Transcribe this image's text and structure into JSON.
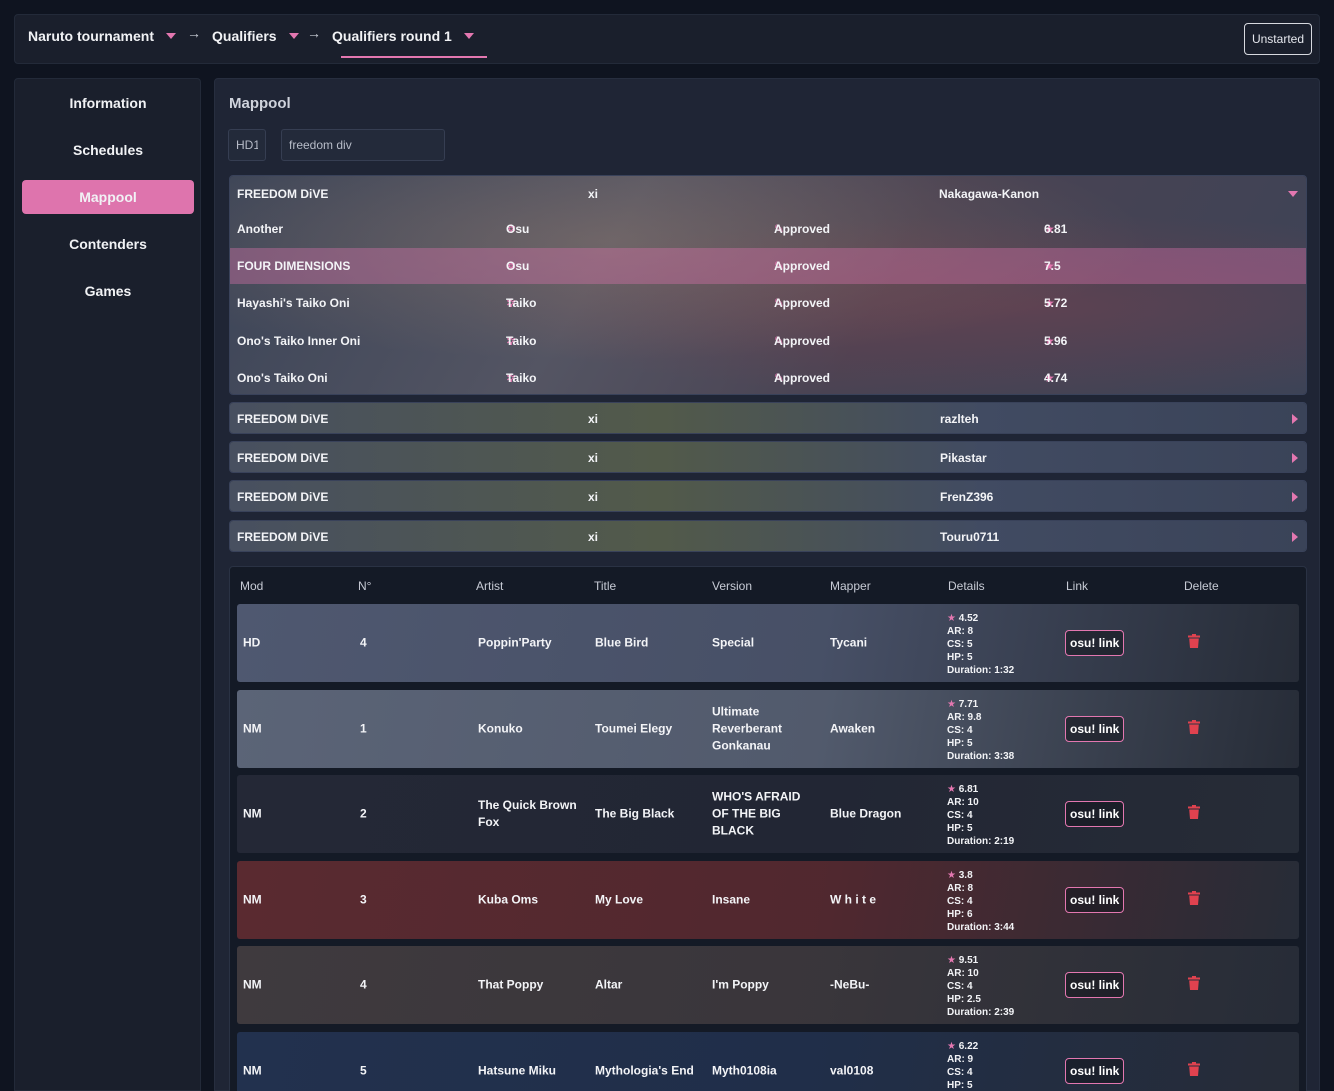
{
  "breadcrumb": {
    "items": [
      "Naruto tournament",
      "Qualifiers",
      "Qualifiers round 1"
    ],
    "status_button": "Unstarted"
  },
  "sidebar": {
    "items": [
      {
        "label": "Information"
      },
      {
        "label": "Schedules"
      },
      {
        "label": "Mappool",
        "active": true
      },
      {
        "label": "Contenders"
      },
      {
        "label": "Games"
      }
    ]
  },
  "mappool": {
    "title": "Mappool",
    "mod_input": {
      "value": "HD1"
    },
    "search_input": {
      "value": "freedom div"
    }
  },
  "beatmapsets": [
    {
      "title": "FREEDOM DiVE",
      "artist": "xi",
      "creator": "Nakagawa-Kanon",
      "expanded": true,
      "difficulties": [
        {
          "name": "Another",
          "mode": "Osu",
          "status": "Approved",
          "stars": "6.81"
        },
        {
          "name": "FOUR DIMENSIONS",
          "mode": "Osu",
          "status": "Approved",
          "stars": "7.5",
          "highlighted": true
        },
        {
          "name": "Hayashi's Taiko Oni",
          "mode": "Taiko",
          "status": "Approved",
          "stars": "5.72"
        },
        {
          "name": "Ono's Taiko Inner Oni",
          "mode": "Taiko",
          "status": "Approved",
          "stars": "5.96"
        },
        {
          "name": "Ono's Taiko Oni",
          "mode": "Taiko",
          "status": "Approved",
          "stars": "4.74"
        }
      ]
    },
    {
      "title": "FREEDOM DiVE",
      "artist": "xi",
      "creator": "razlteh"
    },
    {
      "title": "FREEDOM DiVE",
      "artist": "xi",
      "creator": "Pikastar"
    },
    {
      "title": "FREEDOM DiVE",
      "artist": "xi",
      "creator": "FrenZ396"
    },
    {
      "title": "FREEDOM DiVE",
      "artist": "xi",
      "creator": "Touru0711"
    }
  ],
  "table": {
    "headers": [
      "Mod",
      "N°",
      "Artist",
      "Title",
      "Version",
      "Mapper",
      "Details",
      "Link",
      "Delete"
    ],
    "link_label": "osu! link",
    "rows": [
      {
        "mod": "HD",
        "n": "4",
        "artist": "Poppin'Party",
        "title": "Blue Bird",
        "version": "Special",
        "mapper": "Tycani",
        "stars": "4.52",
        "ar": "AR: 8",
        "cs": "CS: 5",
        "hp": "HP: 5",
        "duration": "Duration: 1:32",
        "color": "#4f5870"
      },
      {
        "mod": "NM",
        "n": "1",
        "artist": "Konuko",
        "title": "Toumei Elegy",
        "version": "Ultimate Reverberant Gonkanau",
        "mapper": "Awaken",
        "stars": "7.71",
        "ar": "AR: 9.8",
        "cs": "CS: 4",
        "hp": "HP: 5",
        "duration": "Duration: 3:38",
        "color": "#5b6477"
      },
      {
        "mod": "NM",
        "n": "2",
        "artist": "The Quick Brown Fox",
        "title": "The Big Black",
        "version": "WHO'S AFRAID OF THE BIG BLACK",
        "mapper": "Blue Dragon",
        "stars": "6.81",
        "ar": "AR: 10",
        "cs": "CS: 4",
        "hp": "HP: 5",
        "duration": "Duration: 2:19",
        "color": "#242836"
      },
      {
        "mod": "NM",
        "n": "3",
        "artist": "Kuba Oms",
        "title": "My Love",
        "version": "Insane",
        "mapper": "W h i t e",
        "stars": "3.8",
        "ar": "AR: 8",
        "cs": "CS: 4",
        "hp": "HP: 6",
        "duration": "Duration: 3:44",
        "color": "#5a2a30"
      },
      {
        "mod": "NM",
        "n": "4",
        "artist": "That Poppy",
        "title": "Altar",
        "version": "I'm Poppy",
        "mapper": "-NeBu-",
        "stars": "9.51",
        "ar": "AR: 10",
        "cs": "CS: 4",
        "hp": "HP: 2.5",
        "duration": "Duration: 2:39",
        "color": "#3f3a3e"
      },
      {
        "mod": "NM",
        "n": "5",
        "artist": "Hatsune Miku",
        "title": "Mythologia's End",
        "version": "Myth0108ia",
        "mapper": "val0108",
        "stars": "6.22",
        "ar": "AR: 9",
        "cs": "CS: 4",
        "hp": "HP: 5",
        "duration": "",
        "color": "#22314e"
      }
    ]
  }
}
